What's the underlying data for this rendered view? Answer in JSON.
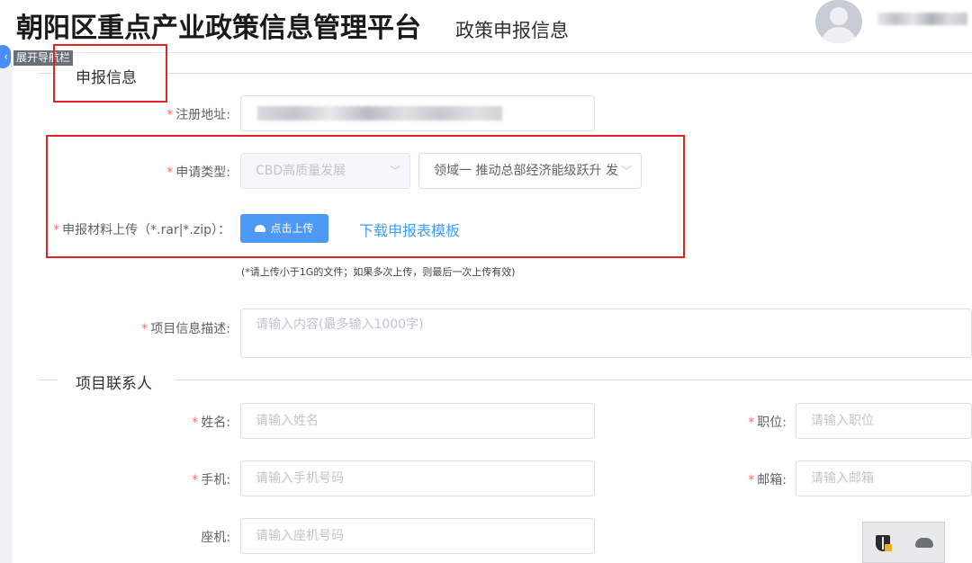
{
  "header": {
    "app_title": "朝阳区重点产业政策信息管理平台",
    "sub_title": "政策申报信息",
    "nav_toggle_label": "展开导航栏"
  },
  "section_apply": {
    "title": "申报信息",
    "required_mark": "*",
    "address_label": "注册地址:",
    "type_label": "申请类型:",
    "type_select_1": "CBD高质量发展",
    "type_select_2": "领域一 推动总部经济能级跃升 发",
    "upload_label": "申报材料上传（*.rar|*.zip）：",
    "upload_button": "点击上传",
    "download_link": "下载申报表模板",
    "upload_hint": "(*请上传小于1G的文件；如果多次上传，则最后一次上传有效)",
    "desc_label": "项目信息描述:",
    "desc_placeholder": "请输入内容(最多输入1000字)"
  },
  "section_contact": {
    "title": "项目联系人",
    "name_label": "姓名:",
    "name_placeholder": "请输入姓名",
    "position_label": "职位:",
    "position_placeholder": "请输入职位",
    "mobile_label": "手机:",
    "mobile_placeholder": "请输入手机号码",
    "email_label": "邮箱:",
    "email_placeholder": "请输入邮箱",
    "phone_label": "座机:",
    "phone_placeholder": "请输入座机号码"
  },
  "icons": {
    "avatar": "user-avatar",
    "chevron": "chevron-down-icon",
    "upload": "cloud-upload-icon",
    "tray_shield": "shield-warning-icon",
    "tray_cloud": "cloud-off-icon"
  },
  "colors": {
    "primary": "#409eff",
    "required": "#f56c6c",
    "annotation": "#e02424"
  }
}
